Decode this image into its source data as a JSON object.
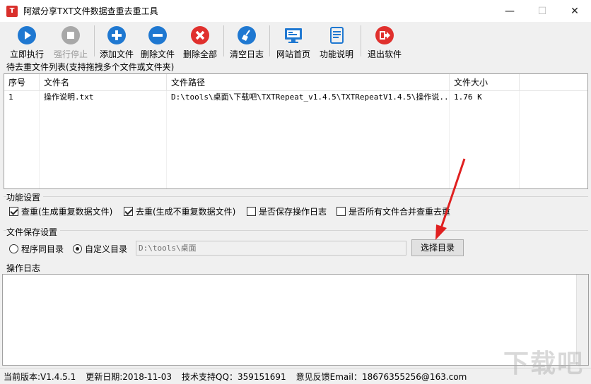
{
  "window": {
    "title": "阿斌分享TXT文件数据查重去重工具",
    "icon_letter": "T",
    "minimize": "—",
    "maximize": "☐",
    "close": "✕"
  },
  "toolbar": {
    "execute": "立即执行",
    "stop": "强行停止",
    "add_file": "添加文件",
    "delete_file": "删除文件",
    "delete_all": "删除全部",
    "clear_log": "清空日志",
    "website": "网站首页",
    "help": "功能说明",
    "exit": "退出软件"
  },
  "file_list": {
    "section_title": "待去重文件列表(支持拖拽多个文件或文件夹)",
    "columns": [
      "序号",
      "文件名",
      "文件路径",
      "文件大小"
    ],
    "rows": [
      [
        "1",
        "操作说明.txt",
        "D:\\tools\\桌面\\下载吧\\TXTRepeat_v1.4.5\\TXTRepeatV1.4.5\\操作说...",
        "1.76 K"
      ]
    ]
  },
  "function_settings": {
    "section_title": "功能设置",
    "options": [
      {
        "label": "查重(生成重复数据文件)",
        "checked": true
      },
      {
        "label": "去重(生成不重复数据文件)",
        "checked": true
      },
      {
        "label": "是否保存操作日志",
        "checked": false
      },
      {
        "label": "是否所有文件合并查重去重",
        "checked": false
      }
    ]
  },
  "save_settings": {
    "section_title": "文件保存设置",
    "radio_same": "程序同目录",
    "radio_custom": "自定义目录",
    "selected": "自定义目录",
    "path": "D:\\tools\\桌面",
    "choose_button": "选择目录"
  },
  "log": {
    "section_title": "操作日志"
  },
  "status": {
    "version": "当前版本:V1.4.5.1",
    "date": "更新日期:2018-11-03",
    "qq": "技术支持QQ：359151691",
    "email": "意见反馈Email：18676355256@163.com"
  },
  "watermark": "下载吧",
  "colors": {
    "blue": "#1f78d1",
    "red": "#e0302d",
    "gray_disabled": "#a8a8a8",
    "annotation_arrow": "#e02020"
  }
}
